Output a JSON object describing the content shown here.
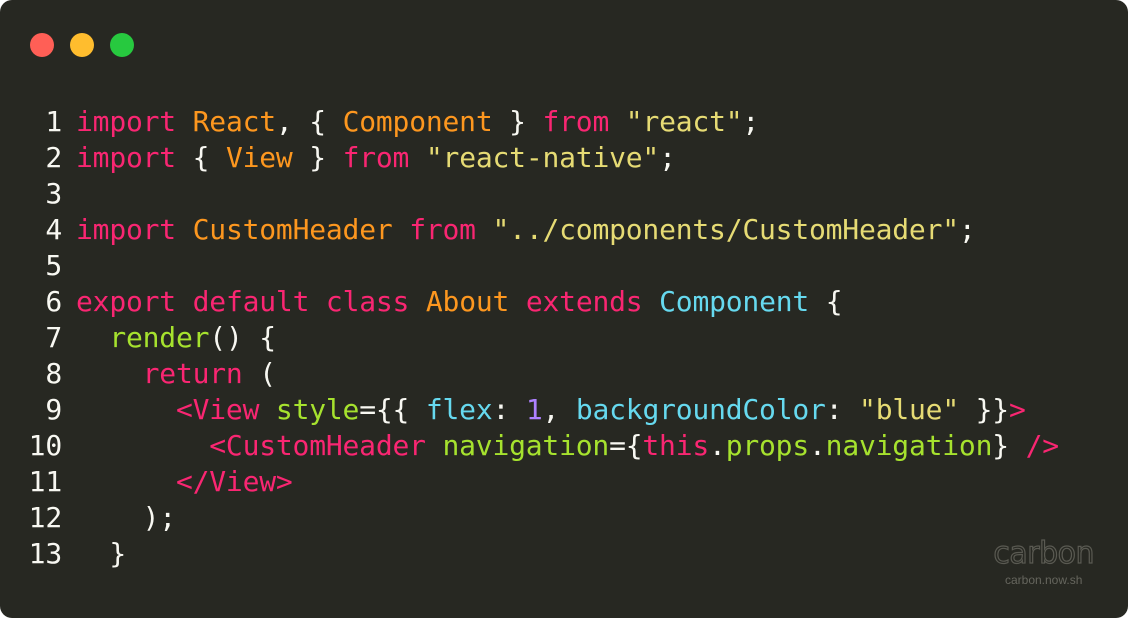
{
  "window": {
    "background": "#272822",
    "controls": {
      "close_color": "#ff5f56",
      "minimize_color": "#ffbd2e",
      "zoom_color": "#27c93f"
    }
  },
  "colors": {
    "keyword": "#f92672",
    "identifier": "#fd971f",
    "plain": "#f8f8f2",
    "string": "#e6db74",
    "type": "#66d9ef",
    "function": "#a6e22e",
    "number": "#ae81ff"
  },
  "code_lines": [
    {
      "number": "1",
      "tokens": [
        {
          "text": "import",
          "type": "keyword"
        },
        {
          "text": " ",
          "type": "plain"
        },
        {
          "text": "React",
          "type": "identifier"
        },
        {
          "text": ", { ",
          "type": "plain"
        },
        {
          "text": "Component",
          "type": "identifier"
        },
        {
          "text": " } ",
          "type": "plain"
        },
        {
          "text": "from",
          "type": "keyword"
        },
        {
          "text": " ",
          "type": "plain"
        },
        {
          "text": "\"react\"",
          "type": "string"
        },
        {
          "text": ";",
          "type": "plain"
        }
      ]
    },
    {
      "number": "2",
      "tokens": [
        {
          "text": "import",
          "type": "keyword"
        },
        {
          "text": " { ",
          "type": "plain"
        },
        {
          "text": "View",
          "type": "identifier"
        },
        {
          "text": " } ",
          "type": "plain"
        },
        {
          "text": "from",
          "type": "keyword"
        },
        {
          "text": " ",
          "type": "plain"
        },
        {
          "text": "\"react-native\"",
          "type": "string"
        },
        {
          "text": ";",
          "type": "plain"
        }
      ]
    },
    {
      "number": "3",
      "tokens": []
    },
    {
      "number": "4",
      "tokens": [
        {
          "text": "import",
          "type": "keyword"
        },
        {
          "text": " ",
          "type": "plain"
        },
        {
          "text": "CustomHeader",
          "type": "identifier"
        },
        {
          "text": " ",
          "type": "plain"
        },
        {
          "text": "from",
          "type": "keyword"
        },
        {
          "text": " ",
          "type": "plain"
        },
        {
          "text": "\"../components/CustomHeader\"",
          "type": "string"
        },
        {
          "text": ";",
          "type": "plain"
        }
      ]
    },
    {
      "number": "5",
      "tokens": []
    },
    {
      "number": "6",
      "tokens": [
        {
          "text": "export",
          "type": "keyword"
        },
        {
          "text": " ",
          "type": "plain"
        },
        {
          "text": "default",
          "type": "keyword"
        },
        {
          "text": " ",
          "type": "plain"
        },
        {
          "text": "class",
          "type": "keyword"
        },
        {
          "text": " ",
          "type": "plain"
        },
        {
          "text": "About",
          "type": "identifier"
        },
        {
          "text": " ",
          "type": "plain"
        },
        {
          "text": "extends",
          "type": "keyword"
        },
        {
          "text": " ",
          "type": "plain"
        },
        {
          "text": "Component",
          "type": "type"
        },
        {
          "text": " {",
          "type": "plain"
        }
      ]
    },
    {
      "number": "7",
      "tokens": [
        {
          "text": "  ",
          "type": "plain"
        },
        {
          "text": "render",
          "type": "function"
        },
        {
          "text": "() {",
          "type": "plain"
        }
      ]
    },
    {
      "number": "8",
      "tokens": [
        {
          "text": "    ",
          "type": "plain"
        },
        {
          "text": "return",
          "type": "keyword"
        },
        {
          "text": " (",
          "type": "plain"
        }
      ]
    },
    {
      "number": "9",
      "tokens": [
        {
          "text": "      ",
          "type": "plain"
        },
        {
          "text": "<View",
          "type": "keyword"
        },
        {
          "text": " ",
          "type": "plain"
        },
        {
          "text": "style",
          "type": "function"
        },
        {
          "text": "={{ ",
          "type": "plain"
        },
        {
          "text": "flex",
          "type": "type"
        },
        {
          "text": ": ",
          "type": "plain"
        },
        {
          "text": "1",
          "type": "number"
        },
        {
          "text": ", ",
          "type": "plain"
        },
        {
          "text": "backgroundColor",
          "type": "type"
        },
        {
          "text": ": ",
          "type": "plain"
        },
        {
          "text": "\"blue\"",
          "type": "string"
        },
        {
          "text": " }}",
          "type": "plain"
        },
        {
          "text": ">",
          "type": "keyword"
        }
      ]
    },
    {
      "number": "10",
      "tokens": [
        {
          "text": "        ",
          "type": "plain"
        },
        {
          "text": "<CustomHeader",
          "type": "keyword"
        },
        {
          "text": " ",
          "type": "plain"
        },
        {
          "text": "navigation",
          "type": "function"
        },
        {
          "text": "={",
          "type": "plain"
        },
        {
          "text": "this",
          "type": "keyword"
        },
        {
          "text": ".",
          "type": "plain"
        },
        {
          "text": "props",
          "type": "function"
        },
        {
          "text": ".",
          "type": "plain"
        },
        {
          "text": "navigation",
          "type": "function"
        },
        {
          "text": "} ",
          "type": "plain"
        },
        {
          "text": "/>",
          "type": "keyword"
        }
      ]
    },
    {
      "number": "11",
      "tokens": [
        {
          "text": "      ",
          "type": "plain"
        },
        {
          "text": "</View>",
          "type": "keyword"
        }
      ]
    },
    {
      "number": "12",
      "tokens": [
        {
          "text": "    );",
          "type": "plain"
        }
      ]
    },
    {
      "number": "13",
      "tokens": [
        {
          "text": "  }",
          "type": "plain"
        }
      ]
    }
  ],
  "watermark": {
    "logo": "carbon",
    "url": "carbon.now.sh"
  }
}
